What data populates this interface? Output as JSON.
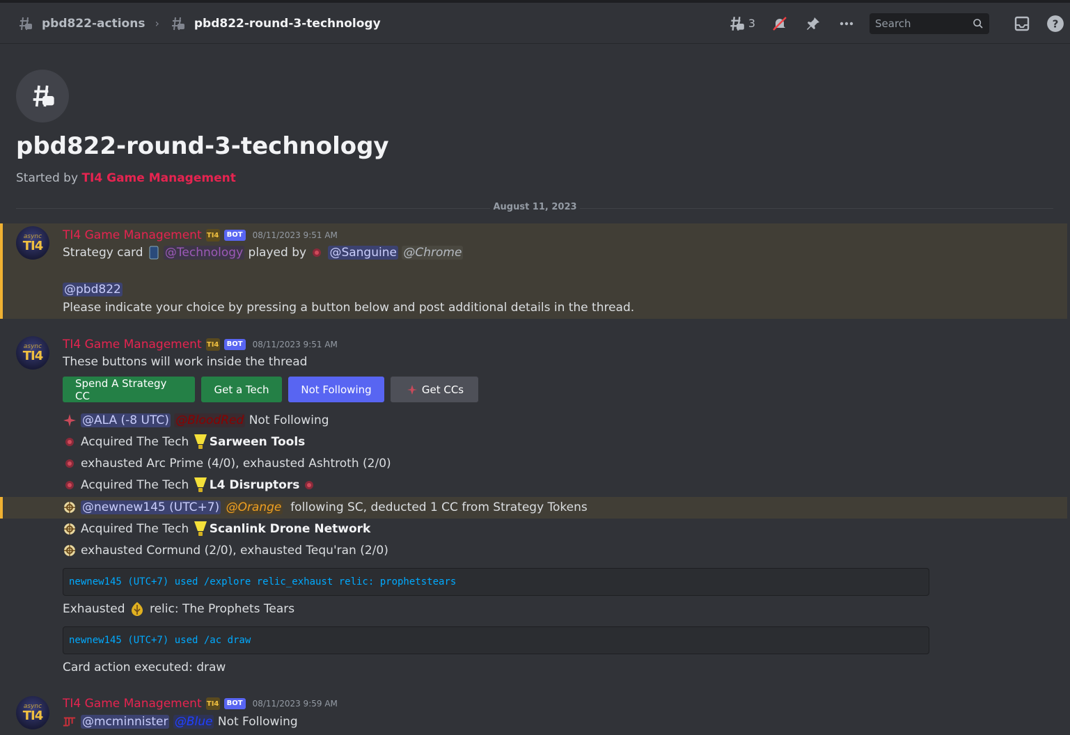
{
  "header": {
    "parent_channel": "pbd822-actions",
    "current_thread": "pbd822-round-3-technology",
    "threads_count": "3",
    "search_placeholder": "Search"
  },
  "thread": {
    "title": "pbd822-round-3-technology",
    "started_by_prefix": "Started by",
    "started_by_name": "TI4 Game Management",
    "date_divider": "August 11, 2023"
  },
  "author": {
    "name": "TI4 Game Management",
    "badge": "BOT",
    "avatar_sub": "async",
    "avatar_main": "TI4"
  },
  "msg1": {
    "timestamp": "08/11/2023 9:51 AM",
    "l1_a": "Strategy card",
    "l1_role": "@Technology",
    "l1_b": "played by",
    "l1_user": "@Sanguine",
    "l1_role2": "@Chrome",
    "l2_mention": "@pbd822",
    "l3": "Please indicate your choice by pressing a button below and post additional details in the thread."
  },
  "msg2": {
    "timestamp": "08/11/2023 9:51 AM",
    "intro": "These buttons will work inside the thread",
    "buttons": {
      "spend": "Spend A Strategy CC",
      "tech": "Get a Tech",
      "not_following": "Not Following",
      "ccs": "Get CCs"
    },
    "r1_user": "@ALA (-8 UTC)",
    "r1_role": "@BloodRed",
    "r1_text": "Not Following",
    "r2_text": "Acquired The Tech",
    "r2_tech": "Sarween Tools",
    "r3_text": "exhausted Arc Prime (4/0), exhausted Ashtroth (2/0)",
    "r4_text": "Acquired The Tech",
    "r4_tech": "L4 Disruptors",
    "r5_user": "@newnew145 (UTC+7)",
    "r5_role": "@Orange",
    "r5_text": "following SC, deducted 1 CC from Strategy Tokens",
    "r6_text": "Acquired The Tech",
    "r6_tech": "Scanlink Drone Network",
    "r7_text": "exhausted Cormund (2/0), exhausted Tequ'ran (2/0)",
    "code1": "newnew145 (UTC+7) used /explore relic_exhaust relic: prophetstears",
    "r8_a": "Exhausted",
    "r8_b": "relic: The Prophets Tears",
    "code2": "newnew145 (UTC+7) used /ac draw",
    "r9": "Card action executed: draw"
  },
  "msg3": {
    "timestamp": "08/11/2023 9:59 AM",
    "user": "@mcminnister",
    "role": "@Blue",
    "text": "Not Following"
  },
  "colors": {
    "author": "#e62450",
    "technology_role": "#9b59b6",
    "bloodred_role": "#8b0000",
    "orange_role": "#f0a020",
    "blue_role": "#2040ff",
    "highlight_border": "#f0b232"
  },
  "icons": [
    "thread-hash-icon",
    "chevron-right-icon",
    "threads-icon",
    "mute-bell-icon",
    "pin-icon",
    "more-icon",
    "search-icon",
    "inbox-icon",
    "help-icon",
    "tech-bulb-icon",
    "faction-icon"
  ]
}
